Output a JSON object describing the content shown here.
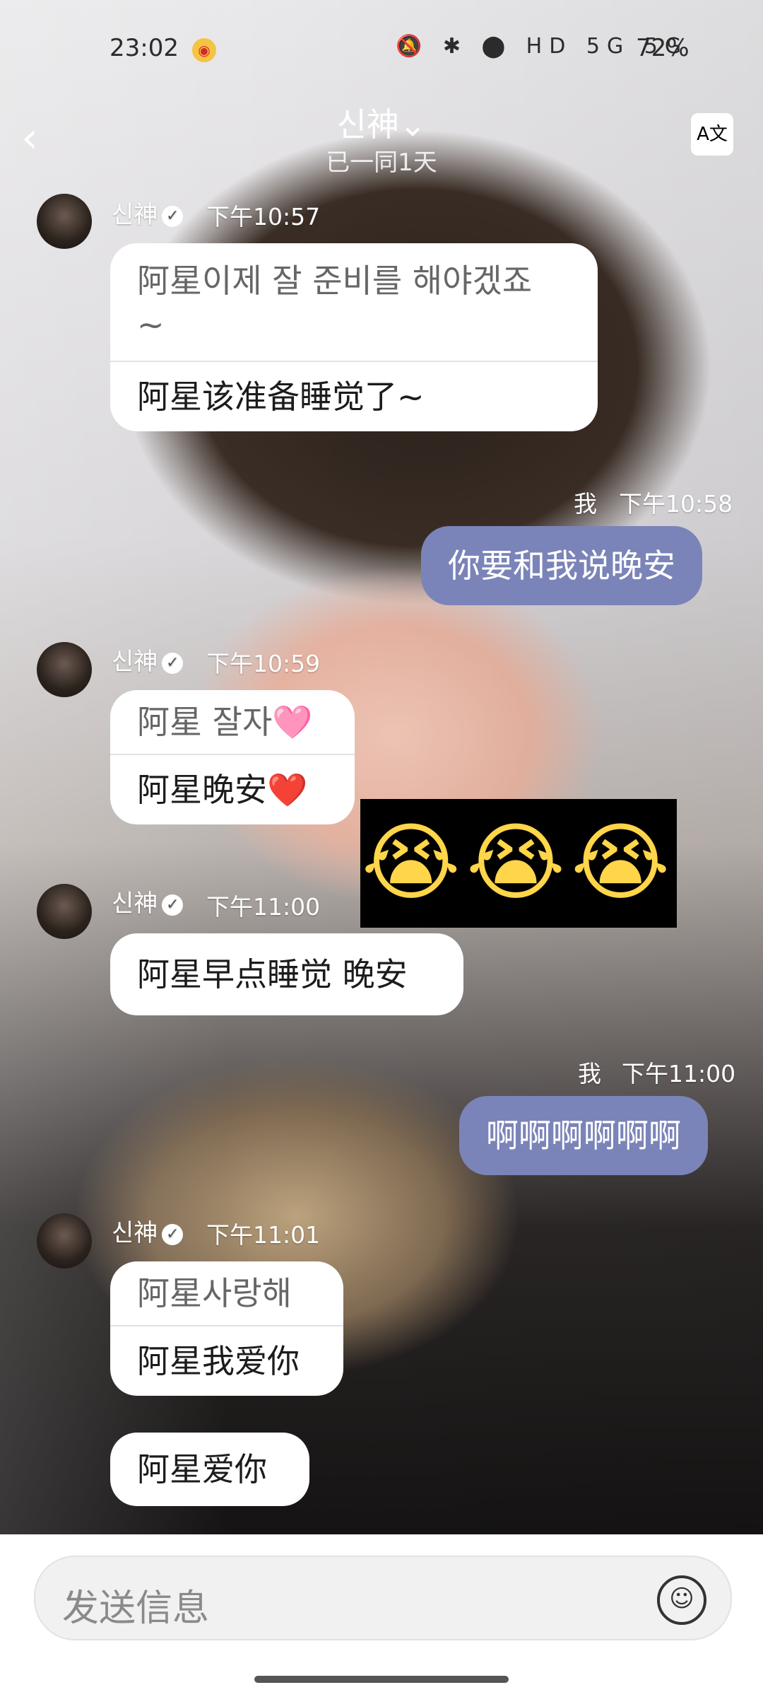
{
  "status_bar": {
    "time": "23:02",
    "right_icons": "🔕 ✱ ⬤ HD 5G 5G",
    "battery": "72%"
  },
  "header": {
    "title": "신神⌄",
    "subtitle": "已一同1天",
    "translate_icon": "A文"
  },
  "messages": [
    {
      "sender": "신神",
      "time": "下午10:57",
      "bubbles": [
        {
          "orig": "阿星이제 잘 준비를 해야겠죠\n~",
          "trans": "阿星该准备睡觉了~"
        }
      ]
    },
    {
      "me_label": "我",
      "time": "下午10:58",
      "text": "你要和我说晚安"
    },
    {
      "sender": "신神",
      "time": "下午10:59",
      "bubbles": [
        {
          "orig": "阿星 잘자🩷",
          "trans": "阿星晚安❤️"
        }
      ]
    },
    {
      "emoji": "😭😭😭"
    },
    {
      "sender": "신神",
      "time": "下午11:00",
      "bubbles": [
        {
          "single": "阿星早点睡觉 晚安"
        }
      ]
    },
    {
      "me_label": "我",
      "time": "下午11:00",
      "text": "啊啊啊啊啊啊"
    },
    {
      "sender": "신神",
      "time": "下午11:01",
      "bubbles": [
        {
          "orig": "阿星사랑해",
          "trans": "阿星我爱你"
        },
        {
          "single": "阿星爱你"
        }
      ]
    }
  ],
  "input": {
    "placeholder": "发送信息"
  }
}
